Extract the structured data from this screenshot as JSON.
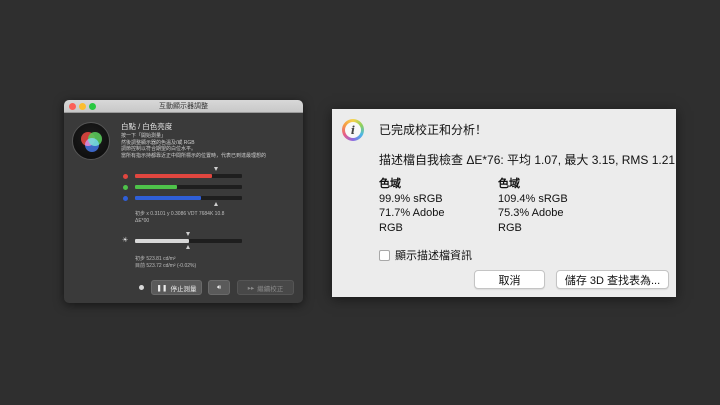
{
  "left_window": {
    "title": "互動顯示器調整",
    "section_title": "白點 / 白色亮度",
    "description": [
      "按一下「開始測量」",
      "然後調整顯示器的色溫及/或 RGB",
      "調節控制以符合期望的白位水平。",
      "當所有指示持都靠近正中間所標示的位置時，代表已到達最理想的"
    ],
    "rgb_sliders": [
      {
        "name": "red",
        "color": "#e0463f",
        "value": 0.72
      },
      {
        "name": "green",
        "color": "#4ec24a",
        "value": 0.39
      },
      {
        "name": "blue",
        "color": "#2f5fd8",
        "value": 0.62
      }
    ],
    "rgb_info": [
      "初步 x 0.3101 y 0.3086 VDT 7684K 10.8",
      "ΔE*00"
    ],
    "luminance_slider": {
      "color": "#d8d8d8",
      "value": 0.5
    },
    "luminance_info": [
      "初步 523.81 cd/m²",
      "目前 523.72 cd/m² (-0.02%)"
    ],
    "buttons": {
      "stop_label": "停止測量",
      "stop_icon": "pause-icon",
      "sound_icon": "speaker-icon",
      "continue_label": "繼續校正"
    }
  },
  "right_dialog": {
    "title": "已完成校正和分析！",
    "summary": "描述檔自我檢查 ΔE*76: 平均 1.07, 最大 3.15, RMS 1.21",
    "gamut_columns": [
      {
        "heading": "色域",
        "lines": [
          "99.9% sRGB",
          "71.7% Adobe",
          "RGB"
        ]
      },
      {
        "heading": "色域",
        "lines": [
          "109.4% sRGB",
          "75.3% Adobe",
          "RGB"
        ]
      }
    ],
    "checkbox_label": "顯示描述檔資訊",
    "checkbox_checked": false,
    "cancel_label": "取消",
    "save_label": "儲存 3D 查找表為..."
  }
}
